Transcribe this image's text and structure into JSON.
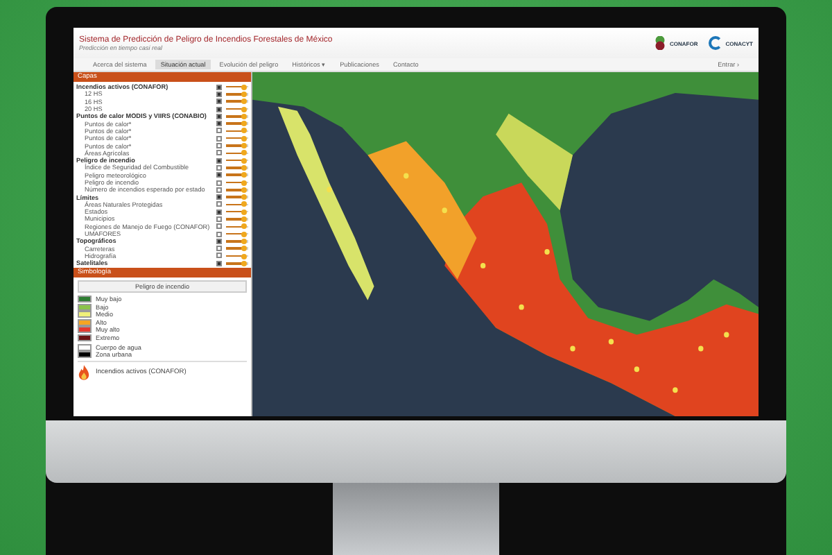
{
  "app": {
    "title": "Sistema de Predicción de Peligro de Incendios Forestales de México",
    "subtitle": "Predicción en tiempo casi real"
  },
  "logos": [
    {
      "label": "CONAFOR"
    },
    {
      "label": "CONACYT"
    }
  ],
  "nav": {
    "items": [
      {
        "label": "Acerca del sistema",
        "selected": false
      },
      {
        "label": "Situación actual",
        "selected": true
      },
      {
        "label": "Evolución del peligro",
        "selected": false
      },
      {
        "label": "Históricos ▾",
        "selected": false
      },
      {
        "label": "Publicaciones",
        "selected": false
      },
      {
        "label": "Contacto",
        "selected": false
      }
    ],
    "login": "Entrar ›"
  },
  "layers": {
    "title": "Capas",
    "items": [
      {
        "label": "Incendios activos (CONAFOR)",
        "checked": true,
        "level": 0.8,
        "children": [
          {
            "label": "12 HS",
            "checked": true,
            "level": 0.8
          },
          {
            "label": "16 HS",
            "checked": true,
            "level": 0.8
          },
          {
            "label": "20 HS",
            "checked": true,
            "level": 0.8
          }
        ]
      },
      {
        "label": "Puntos de calor MODIS y VIIRS (CONABIO)",
        "checked": true,
        "level": 0.8,
        "children": [
          {
            "label": "Puntos de calor*",
            "checked": true,
            "level": 0.8
          },
          {
            "label": "Puntos de calor*",
            "checked": false,
            "level": 0.8
          },
          {
            "label": "Puntos de calor*",
            "checked": false,
            "level": 0.8
          },
          {
            "label": "Puntos de calor*",
            "checked": false,
            "level": 0.8
          },
          {
            "label": "Áreas Agrícolas",
            "checked": false,
            "level": 0.8
          }
        ]
      },
      {
        "label": "Peligro de incendio",
        "checked": true,
        "level": 0.8,
        "children": [
          {
            "label": "Índice de Seguridad del Combustible",
            "checked": false,
            "level": 0.8
          },
          {
            "label": "Peligro meteorológico",
            "checked": true,
            "level": 0.8
          },
          {
            "label": "Peligro de incendio",
            "checked": false,
            "level": 0.8
          },
          {
            "label": "Número de incendios esperado por estado",
            "checked": false,
            "level": 0.8
          }
        ]
      },
      {
        "label": "Límites",
        "checked": true,
        "level": 0.8,
        "children": [
          {
            "label": "Áreas Naturales Protegidas",
            "checked": false,
            "level": 0.8
          },
          {
            "label": "Estados",
            "checked": true,
            "level": 0.8
          },
          {
            "label": "Municipios",
            "checked": false,
            "level": 0.8
          },
          {
            "label": "Regiones de Manejo de Fuego (CONAFOR)",
            "checked": false,
            "level": 0.8
          },
          {
            "label": "UMAFORES",
            "checked": false,
            "level": 0.8
          }
        ]
      },
      {
        "label": "Topográficos",
        "checked": true,
        "level": 0.8,
        "children": [
          {
            "label": "Carreteras",
            "checked": false,
            "level": 0.8
          },
          {
            "label": "Hidrografía",
            "checked": false,
            "level": 0.8
          }
        ]
      },
      {
        "label": "Satelitales",
        "checked": true,
        "level": 0.8
      }
    ]
  },
  "legend": {
    "title": "Simbología",
    "heading": "Peligro de incendio",
    "items": [
      {
        "label": "Muy bajo",
        "color": "#2e7d32"
      },
      {
        "label": "Bajo",
        "color": "#8bc34a"
      },
      {
        "label": "Medio",
        "color": "#f0f07a"
      },
      {
        "label": "Alto",
        "color": "#f5a623"
      },
      {
        "label": "Muy alto",
        "color": "#e53a2f"
      },
      {
        "label": "Extremo",
        "color": "#6d1414"
      }
    ],
    "extra": [
      {
        "label": "Cuerpo de agua",
        "color": "#ffffff"
      },
      {
        "label": "Zona urbana",
        "color": "#000000"
      }
    ],
    "fire": "Incendios activos (CONAFOR)"
  }
}
